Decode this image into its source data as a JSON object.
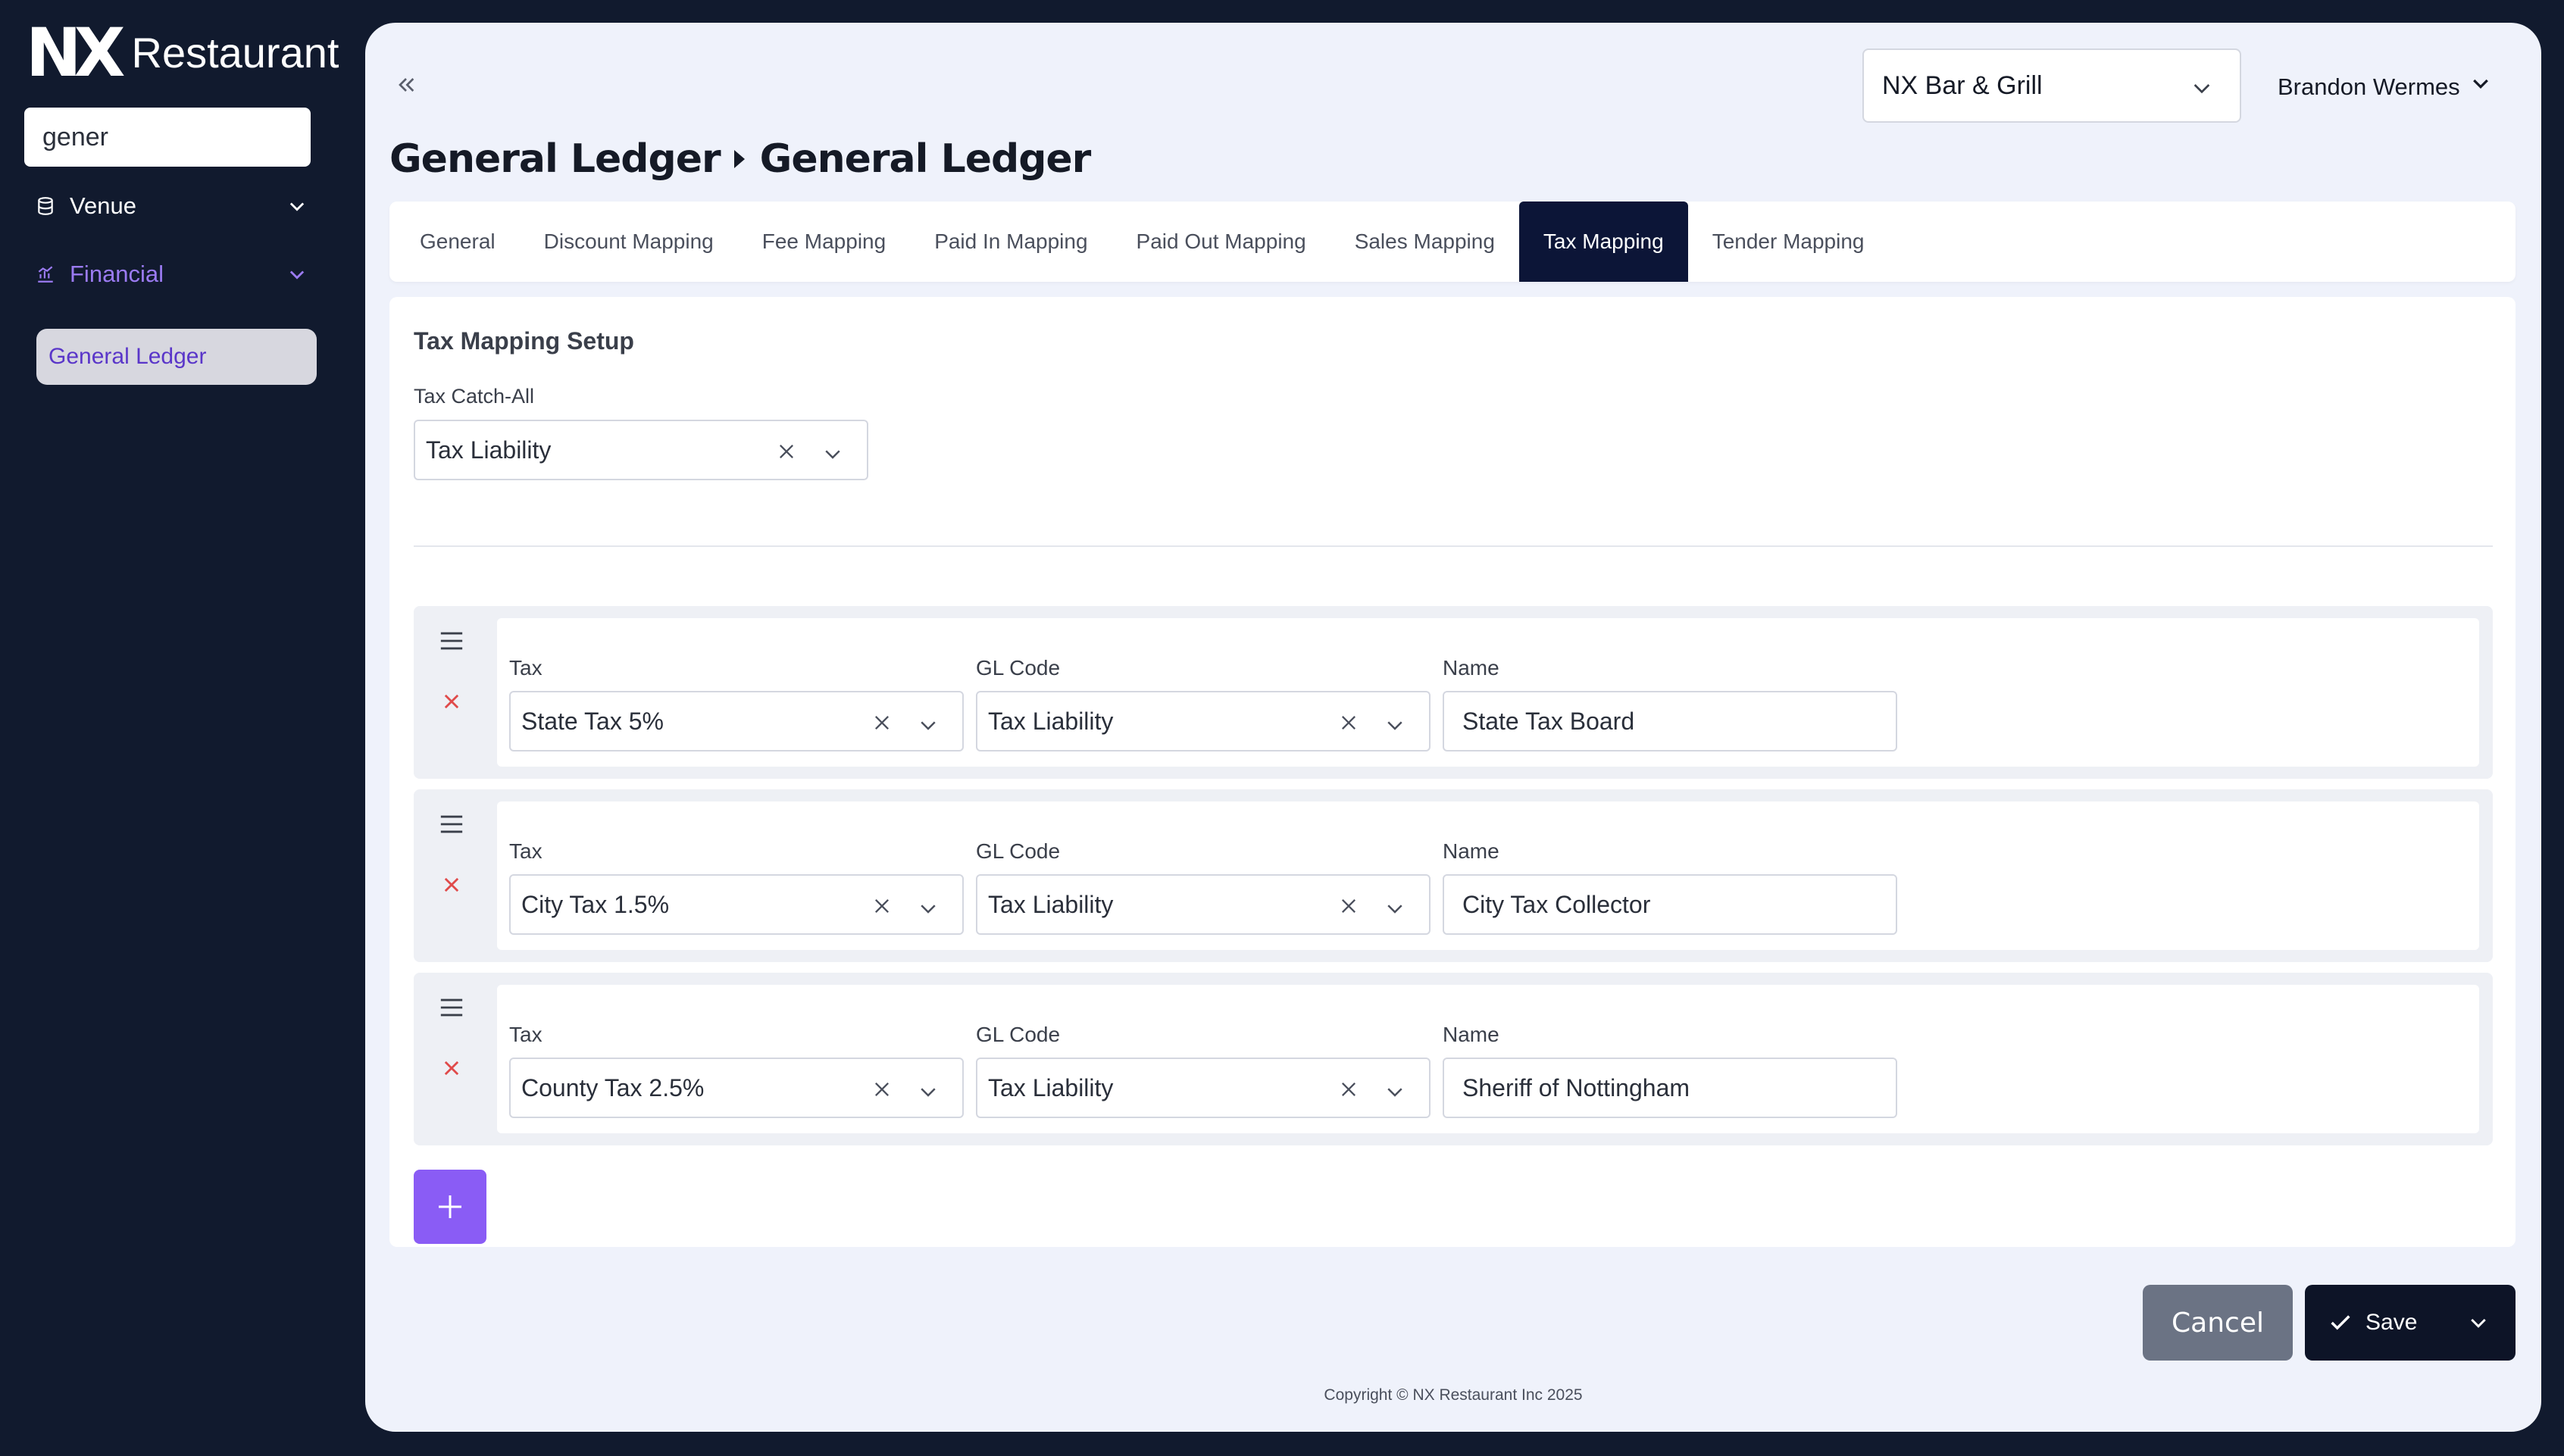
{
  "brand": {
    "mark": "NX",
    "name": "Restaurant"
  },
  "sidebar": {
    "search_value": "gener",
    "items": [
      {
        "label": "Venue"
      },
      {
        "label": "Financial"
      }
    ],
    "sub_item": "General Ledger"
  },
  "header": {
    "venue": "NX Bar & Grill",
    "user": "Brandon Wermes",
    "breadcrumb": [
      "General Ledger",
      "General Ledger"
    ]
  },
  "tabs": [
    "General",
    "Discount Mapping",
    "Fee Mapping",
    "Paid In Mapping",
    "Paid Out Mapping",
    "Sales Mapping",
    "Tax Mapping",
    "Tender Mapping"
  ],
  "active_tab": "Tax Mapping",
  "setup": {
    "title": "Tax Mapping Setup",
    "catch_all_label": "Tax Catch-All",
    "catch_all_value": "Tax Liability"
  },
  "labels": {
    "tax": "Tax",
    "gl_code": "GL Code",
    "name": "Name"
  },
  "rows": [
    {
      "tax": "State Tax 5%",
      "gl_code": "Tax Liability",
      "name": "State Tax Board"
    },
    {
      "tax": "City Tax 1.5%",
      "gl_code": "Tax Liability",
      "name": "City Tax Collector"
    },
    {
      "tax": "County Tax 2.5%",
      "gl_code": "Tax Liability",
      "name": "Sheriff of Nottingham"
    }
  ],
  "actions": {
    "cancel": "Cancel",
    "save": "Save"
  },
  "footer": {
    "copyright": "Copyright © NX Restaurant Inc 2025"
  },
  "colors": {
    "sidebar_bg": "#111a2e",
    "panel_bg": "#eff2fb",
    "active_tab_bg": "#0c1537",
    "accent_purple": "#8a5cf5",
    "remove_red": "#e04a4a",
    "cancel_gray": "#6b7384"
  },
  "icons": {
    "collapse": "double-chevron-left-icon",
    "drag": "drag-handle-icon",
    "remove": "close-icon",
    "add": "plus-icon",
    "dropdown": "chevron-down-icon",
    "clear": "clear-icon",
    "save": "check-icon"
  }
}
